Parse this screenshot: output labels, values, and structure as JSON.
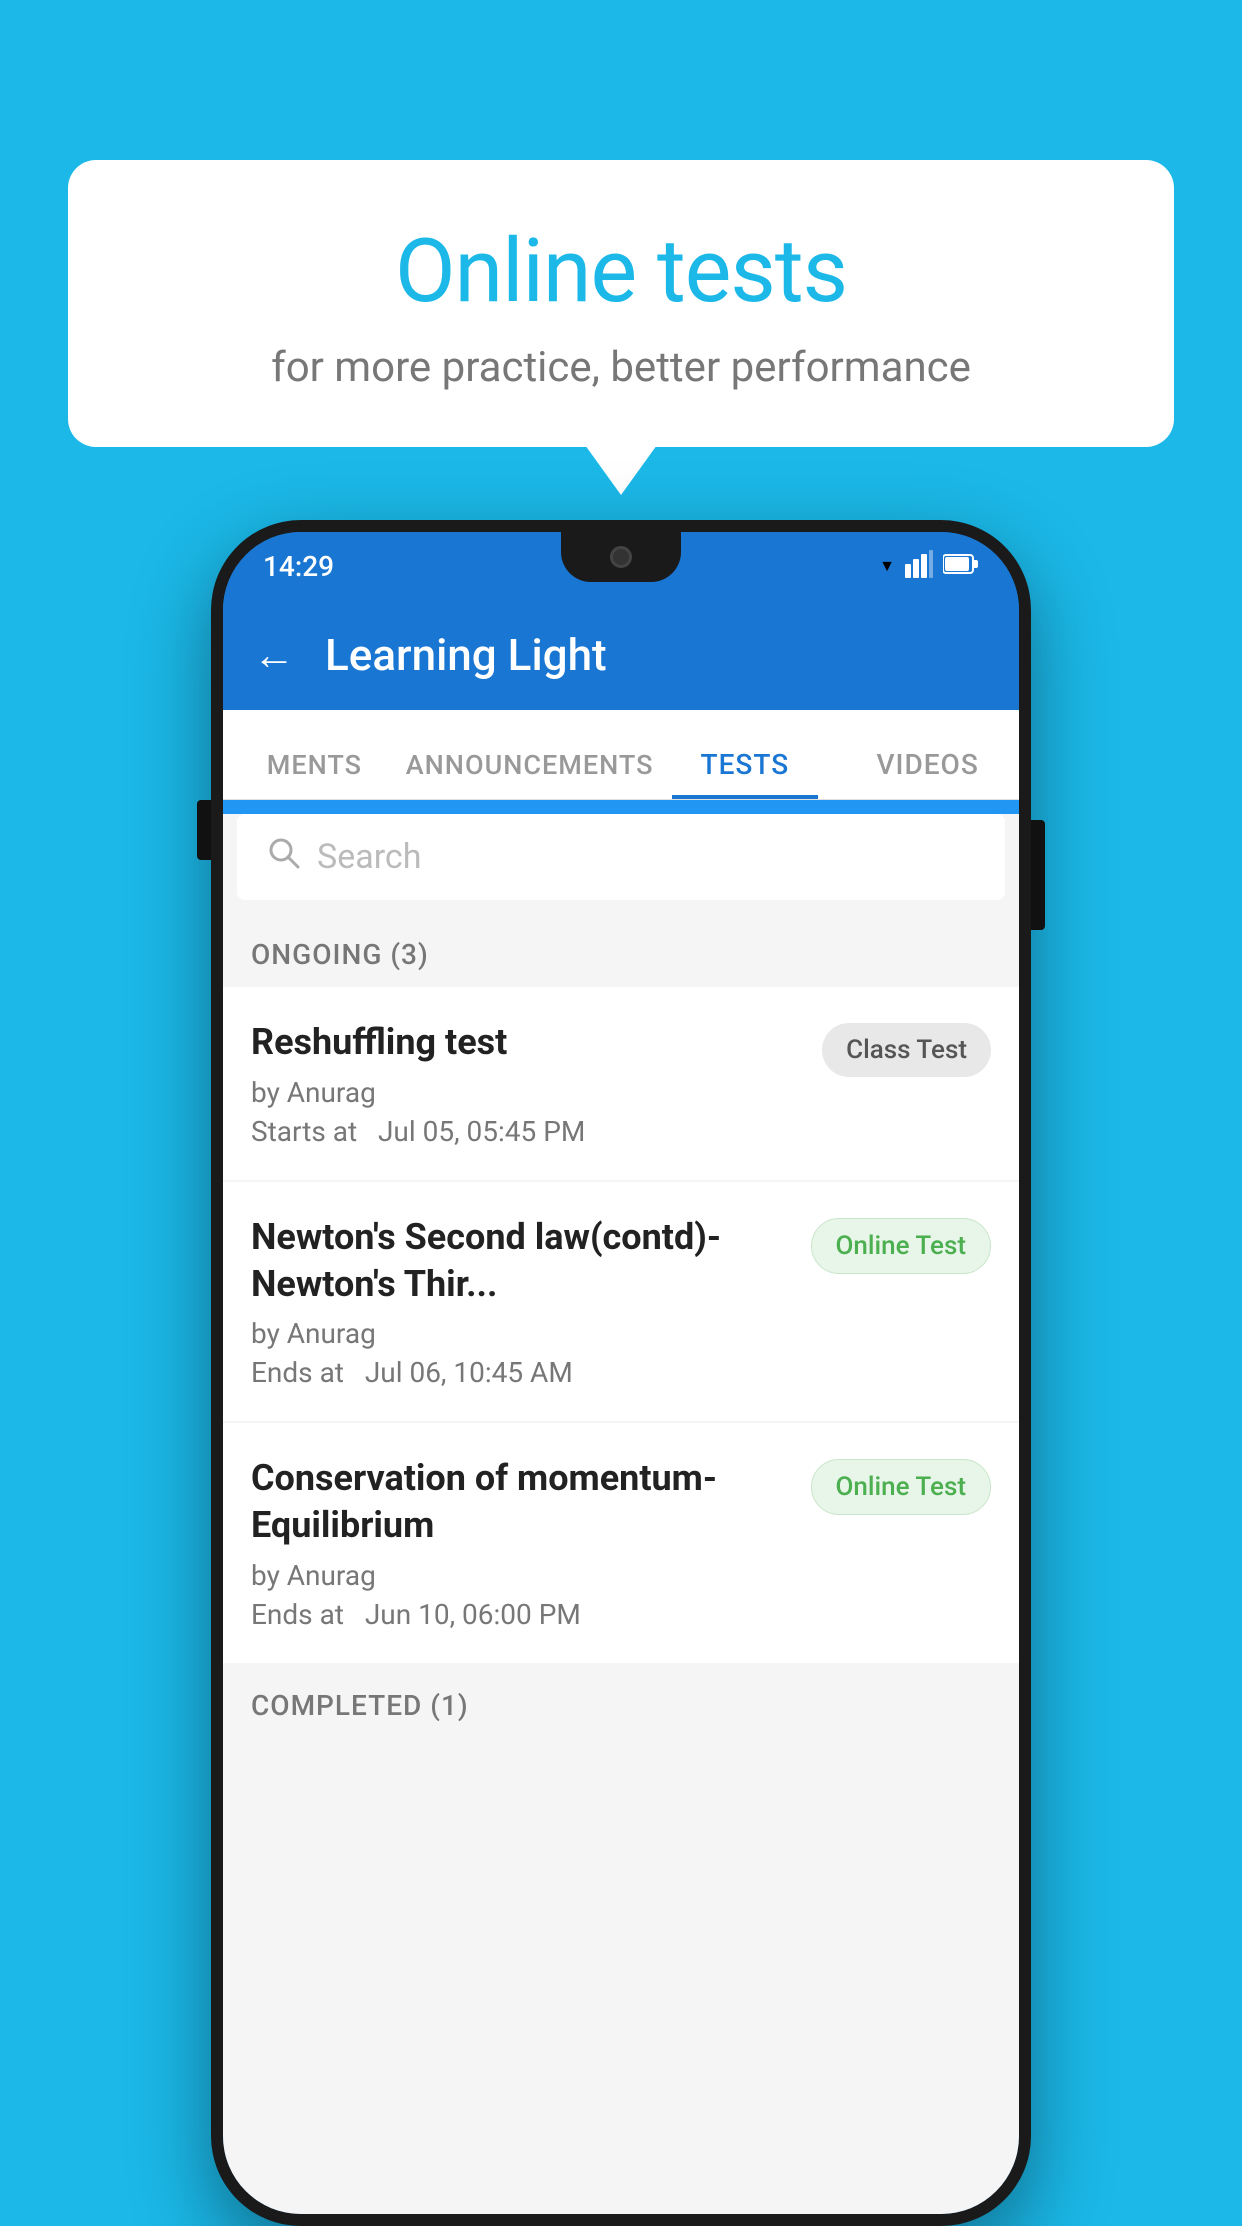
{
  "background": {
    "color": "#1bb8e8"
  },
  "speech_bubble": {
    "title": "Online tests",
    "subtitle": "for more practice, better performance"
  },
  "status_bar": {
    "time": "14:29",
    "wifi": "▼",
    "signal": "◀",
    "battery": "▮"
  },
  "app_header": {
    "back_label": "←",
    "title": "Learning Light"
  },
  "tabs": [
    {
      "label": "MENTS",
      "active": false,
      "key": "ments"
    },
    {
      "label": "ANNOUNCEMENTS",
      "active": false,
      "key": "announcements"
    },
    {
      "label": "TESTS",
      "active": true,
      "key": "tests"
    },
    {
      "label": "VIDEOS",
      "active": false,
      "key": "videos"
    }
  ],
  "search": {
    "placeholder": "Search"
  },
  "ongoing_section": {
    "label": "ONGOING (3)"
  },
  "tests": [
    {
      "name": "Reshuffling test",
      "by": "by Anurag",
      "date_label": "Starts at",
      "date": "Jul 05, 05:45 PM",
      "badge": "Class Test",
      "badge_type": "class"
    },
    {
      "name": "Newton's Second law(contd)-Newton's Thir...",
      "by": "by Anurag",
      "date_label": "Ends at",
      "date": "Jul 06, 10:45 AM",
      "badge": "Online Test",
      "badge_type": "online"
    },
    {
      "name": "Conservation of momentum-Equilibrium",
      "by": "by Anurag",
      "date_label": "Ends at",
      "date": "Jun 10, 06:00 PM",
      "badge": "Online Test",
      "badge_type": "online"
    }
  ],
  "completed_section": {
    "label": "COMPLETED (1)"
  }
}
